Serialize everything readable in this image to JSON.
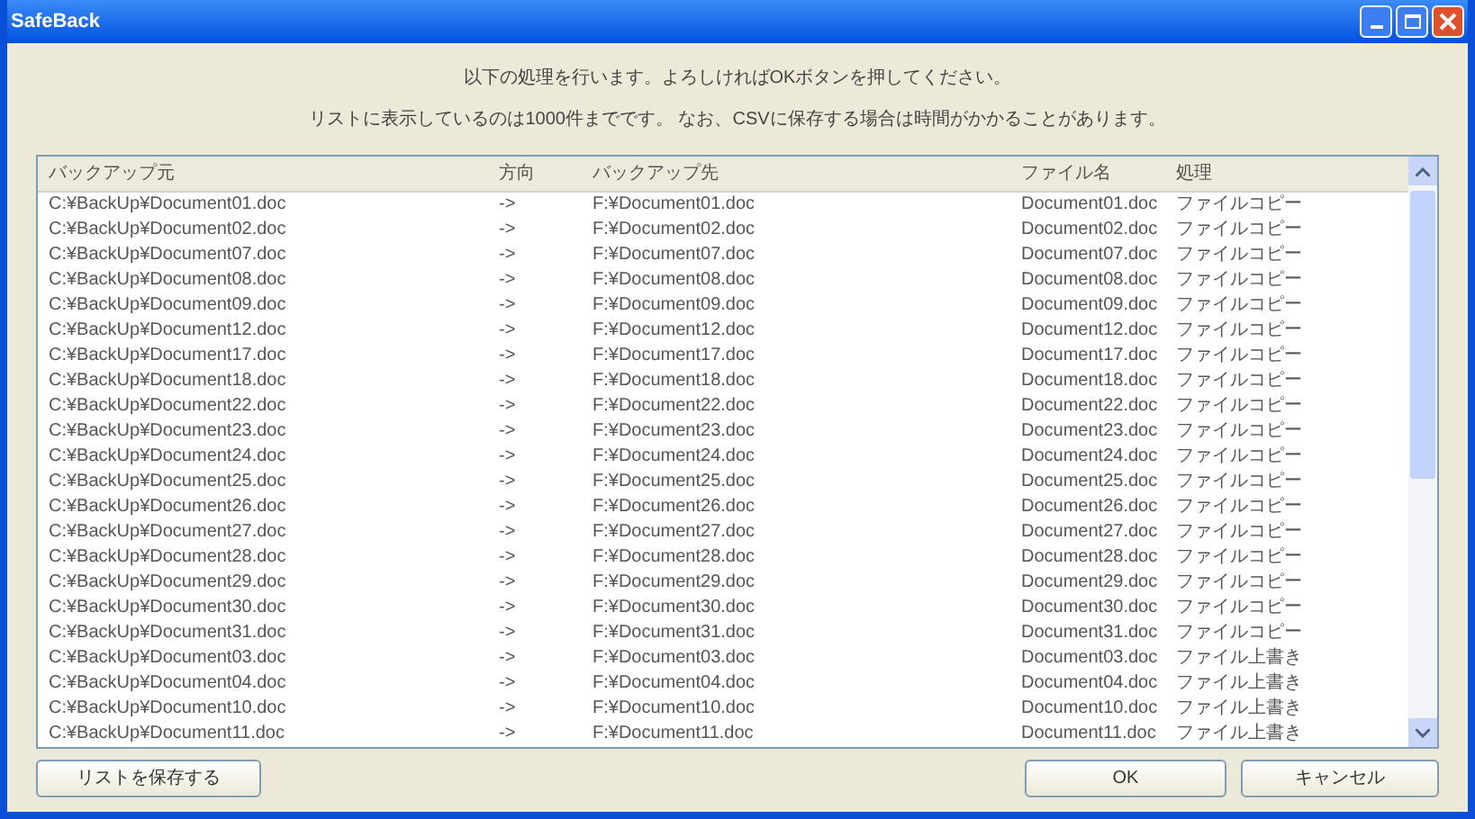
{
  "window": {
    "title": "SafeBack"
  },
  "message": [
    "以下の処理を行います。よろしければOKボタンを押してください。",
    "リストに表示しているのは1000件までです。 なお、CSVに保存する場合は時間がかかることがあります。"
  ],
  "table": {
    "columns": [
      "バックアップ元",
      "方向",
      "バックアップ先",
      "ファイル名",
      "処理"
    ],
    "rows": [
      [
        "C:¥BackUp¥Document01.doc",
        "->",
        "F:¥Document01.doc",
        "Document01.doc",
        "ファイルコピー"
      ],
      [
        "C:¥BackUp¥Document02.doc",
        "->",
        "F:¥Document02.doc",
        "Document02.doc",
        "ファイルコピー"
      ],
      [
        "C:¥BackUp¥Document07.doc",
        "->",
        "F:¥Document07.doc",
        "Document07.doc",
        "ファイルコピー"
      ],
      [
        "C:¥BackUp¥Document08.doc",
        "->",
        "F:¥Document08.doc",
        "Document08.doc",
        "ファイルコピー"
      ],
      [
        "C:¥BackUp¥Document09.doc",
        "->",
        "F:¥Document09.doc",
        "Document09.doc",
        "ファイルコピー"
      ],
      [
        "C:¥BackUp¥Document12.doc",
        "->",
        "F:¥Document12.doc",
        "Document12.doc",
        "ファイルコピー"
      ],
      [
        "C:¥BackUp¥Document17.doc",
        "->",
        "F:¥Document17.doc",
        "Document17.doc",
        "ファイルコピー"
      ],
      [
        "C:¥BackUp¥Document18.doc",
        "->",
        "F:¥Document18.doc",
        "Document18.doc",
        "ファイルコピー"
      ],
      [
        "C:¥BackUp¥Document22.doc",
        "->",
        "F:¥Document22.doc",
        "Document22.doc",
        "ファイルコピー"
      ],
      [
        "C:¥BackUp¥Document23.doc",
        "->",
        "F:¥Document23.doc",
        "Document23.doc",
        "ファイルコピー"
      ],
      [
        "C:¥BackUp¥Document24.doc",
        "->",
        "F:¥Document24.doc",
        "Document24.doc",
        "ファイルコピー"
      ],
      [
        "C:¥BackUp¥Document25.doc",
        "->",
        "F:¥Document25.doc",
        "Document25.doc",
        "ファイルコピー"
      ],
      [
        "C:¥BackUp¥Document26.doc",
        "->",
        "F:¥Document26.doc",
        "Document26.doc",
        "ファイルコピー"
      ],
      [
        "C:¥BackUp¥Document27.doc",
        "->",
        "F:¥Document27.doc",
        "Document27.doc",
        "ファイルコピー"
      ],
      [
        "C:¥BackUp¥Document28.doc",
        "->",
        "F:¥Document28.doc",
        "Document28.doc",
        "ファイルコピー"
      ],
      [
        "C:¥BackUp¥Document29.doc",
        "->",
        "F:¥Document29.doc",
        "Document29.doc",
        "ファイルコピー"
      ],
      [
        "C:¥BackUp¥Document30.doc",
        "->",
        "F:¥Document30.doc",
        "Document30.doc",
        "ファイルコピー"
      ],
      [
        "C:¥BackUp¥Document31.doc",
        "->",
        "F:¥Document31.doc",
        "Document31.doc",
        "ファイルコピー"
      ],
      [
        "C:¥BackUp¥Document03.doc",
        "->",
        "F:¥Document03.doc",
        "Document03.doc",
        "ファイル上書き"
      ],
      [
        "C:¥BackUp¥Document04.doc",
        "->",
        "F:¥Document04.doc",
        "Document04.doc",
        "ファイル上書き"
      ],
      [
        "C:¥BackUp¥Document10.doc",
        "->",
        "F:¥Document10.doc",
        "Document10.doc",
        "ファイル上書き"
      ],
      [
        "C:¥BackUp¥Document11.doc",
        "->",
        "F:¥Document11.doc",
        "Document11.doc",
        "ファイル上書き"
      ]
    ]
  },
  "buttons": {
    "save": "リストを保存する",
    "ok": "OK",
    "cancel": "キャンセル"
  }
}
